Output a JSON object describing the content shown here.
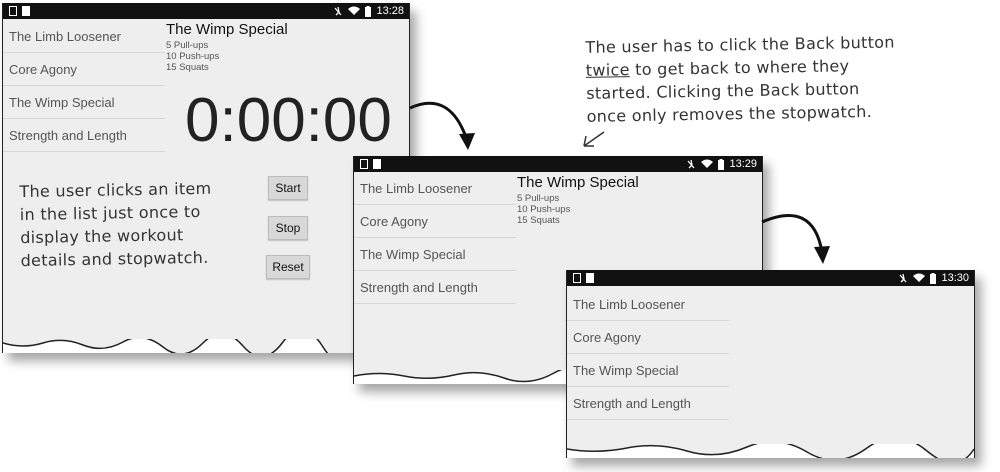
{
  "workout_list": [
    "The Limb Loosener",
    "Core Agony",
    "The Wimp Special",
    "Strength and Length"
  ],
  "detail": {
    "title": "The Wimp Special",
    "lines": [
      "5 Pull-ups",
      "10 Push-ups",
      "15 Squats"
    ]
  },
  "stopwatch": {
    "time": "0:00:00",
    "start_label": "Start",
    "stop_label": "Stop",
    "reset_label": "Reset"
  },
  "screens": [
    {
      "clock": "13:28"
    },
    {
      "clock": "13:29"
    },
    {
      "clock": "13:30"
    }
  ],
  "annotations": {
    "left_note": [
      "The user clicks an item",
      "in the list just once to",
      "display the workout",
      "details and stopwatch."
    ],
    "right_note_pre": "The user has to click the Back button",
    "right_note_emph": "twice",
    "right_note_post": " to get back to where they",
    "right_note_rest": [
      "started. Clicking the Back button",
      "once only removes the stopwatch."
    ]
  },
  "icons": [
    "mute-icon",
    "wifi-icon",
    "battery-icon",
    "arrow-icon"
  ]
}
